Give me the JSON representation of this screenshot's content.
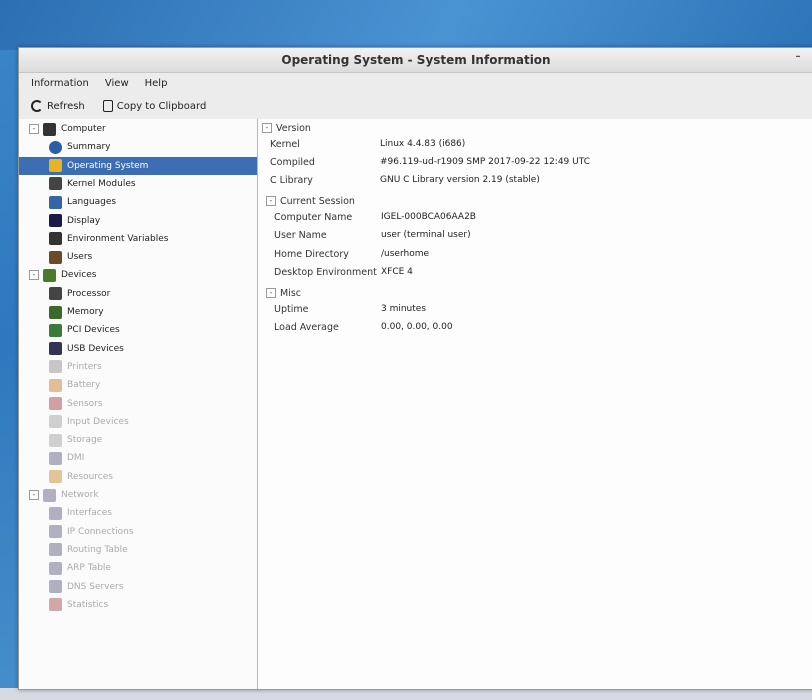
{
  "window": {
    "title": "Operating System - System Information"
  },
  "menu": [
    "Information",
    "View",
    "Help"
  ],
  "toolbar": {
    "refresh": "Refresh",
    "copy": "Copy to Clipboard"
  },
  "sidebar": {
    "items": [
      {
        "label": "Computer",
        "icon": "computer-icon",
        "color": "#333",
        "level": 0,
        "expander": "-"
      },
      {
        "label": "Summary",
        "icon": "info-icon",
        "color": "#2a5fa8",
        "level": 1
      },
      {
        "label": "Operating System",
        "icon": "os-icon",
        "color": "#e6b422",
        "level": 1,
        "selected": true
      },
      {
        "label": "Kernel Modules",
        "icon": "kernel-icon",
        "color": "#444",
        "level": 1
      },
      {
        "label": "Languages",
        "icon": "languages-icon",
        "color": "#3466a4",
        "level": 1
      },
      {
        "label": "Display",
        "icon": "display-icon",
        "color": "#1a1a4a",
        "level": 1
      },
      {
        "label": "Environment Variables",
        "icon": "terminal-icon",
        "color": "#333",
        "level": 1
      },
      {
        "label": "Users",
        "icon": "users-icon",
        "color": "#6b4a2a",
        "level": 1
      },
      {
        "label": "Devices",
        "icon": "devices-icon",
        "color": "#4a7a2a",
        "level": 0,
        "expander": "-"
      },
      {
        "label": "Processor",
        "icon": "processor-icon",
        "color": "#444",
        "level": 1
      },
      {
        "label": "Memory",
        "icon": "memory-icon",
        "color": "#3a6a2a",
        "level": 1
      },
      {
        "label": "PCI Devices",
        "icon": "pci-icon",
        "color": "#3a7a3a",
        "level": 1
      },
      {
        "label": "USB Devices",
        "icon": "usb-icon",
        "color": "#335",
        "level": 1
      },
      {
        "label": "Printers",
        "icon": "printer-icon",
        "color": "#888",
        "level": 1,
        "faded": true
      },
      {
        "label": "Battery",
        "icon": "battery-icon",
        "color": "#c07020",
        "level": 1,
        "faded": true
      },
      {
        "label": "Sensors",
        "icon": "sensor-icon",
        "color": "#a03030",
        "level": 1,
        "faded": true
      },
      {
        "label": "Input Devices",
        "icon": "input-icon",
        "color": "#999",
        "level": 1,
        "faded": true
      },
      {
        "label": "Storage",
        "icon": "storage-icon",
        "color": "#999",
        "level": 1,
        "faded": true
      },
      {
        "label": "DMI",
        "icon": "dmi-icon",
        "color": "#557",
        "level": 1,
        "faded": true
      },
      {
        "label": "Resources",
        "icon": "resources-icon",
        "color": "#c08020",
        "level": 1,
        "faded": true
      },
      {
        "label": "Network",
        "icon": "network-icon",
        "color": "#557",
        "level": 0,
        "expander": "-",
        "faded": true
      },
      {
        "label": "Interfaces",
        "icon": "interface-icon",
        "color": "#557",
        "level": 1,
        "faded": true
      },
      {
        "label": "IP Connections",
        "icon": "connections-icon",
        "color": "#557",
        "level": 1,
        "faded": true
      },
      {
        "label": "Routing Table",
        "icon": "routing-icon",
        "color": "#557",
        "level": 1,
        "faded": true
      },
      {
        "label": "ARP Table",
        "icon": "arp-icon",
        "color": "#557",
        "level": 1,
        "faded": true
      },
      {
        "label": "DNS Servers",
        "icon": "dns-icon",
        "color": "#557",
        "level": 1,
        "faded": true
      },
      {
        "label": "Statistics",
        "icon": "statistics-icon",
        "color": "#a04040",
        "level": 1,
        "faded": true
      }
    ]
  },
  "sections": [
    {
      "title": "Version",
      "rows": [
        {
          "label": "Kernel",
          "value": "Linux 4.4.83 (i686)"
        },
        {
          "label": "Compiled",
          "value": "#96.119-ud-r1909 SMP 2017-09-22 12:49 UTC"
        },
        {
          "label": "C Library",
          "value": "GNU C Library version 2.19 (stable)"
        }
      ]
    },
    {
      "title": "Current Session",
      "rows": [
        {
          "label": "Computer Name",
          "value": "IGEL-000BCA06AA2B"
        },
        {
          "label": "User Name",
          "value": "user (terminal user)"
        },
        {
          "label": "Home Directory",
          "value": "/userhome"
        },
        {
          "label": "Desktop Environment",
          "value": "XFCE 4"
        }
      ]
    },
    {
      "title": "Misc",
      "rows": [
        {
          "label": "Uptime",
          "value": "3 minutes"
        },
        {
          "label": "Load Average",
          "value": "0.00, 0.00, 0.00"
        }
      ]
    }
  ]
}
